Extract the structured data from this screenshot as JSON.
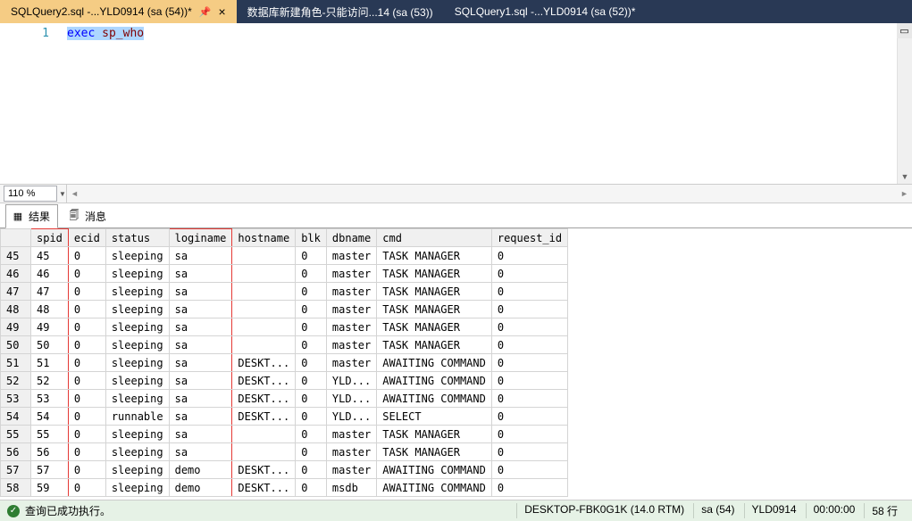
{
  "tabs": [
    {
      "label": "SQLQuery2.sql -...YLD0914 (sa (54))*",
      "active": true,
      "pinned": true
    },
    {
      "label": "数据库新建角色-只能访问...14 (sa (53))",
      "active": false
    },
    {
      "label": "SQLQuery1.sql -...YLD0914 (sa (52))*",
      "active": false
    }
  ],
  "editor": {
    "line_number": "1",
    "code_exec": "exec",
    "code_sp": " sp_who"
  },
  "zoom": {
    "value": "110 %"
  },
  "results_tabs": {
    "results": "结果",
    "messages": "消息"
  },
  "grid": {
    "columns": [
      "spid",
      "ecid",
      "status",
      "loginame",
      "hostname",
      "blk",
      "dbname",
      "cmd",
      "request_id"
    ],
    "rows": [
      {
        "n": "45",
        "spid": "45",
        "ecid": "0",
        "status": "sleeping",
        "loginame": "sa",
        "hostname": "",
        "blk": "0",
        "dbname": "master",
        "cmd": "TASK MANAGER",
        "request_id": "0"
      },
      {
        "n": "46",
        "spid": "46",
        "ecid": "0",
        "status": "sleeping",
        "loginame": "sa",
        "hostname": "",
        "blk": "0",
        "dbname": "master",
        "cmd": "TASK MANAGER",
        "request_id": "0"
      },
      {
        "n": "47",
        "spid": "47",
        "ecid": "0",
        "status": "sleeping",
        "loginame": "sa",
        "hostname": "",
        "blk": "0",
        "dbname": "master",
        "cmd": "TASK MANAGER",
        "request_id": "0"
      },
      {
        "n": "48",
        "spid": "48",
        "ecid": "0",
        "status": "sleeping",
        "loginame": "sa",
        "hostname": "",
        "blk": "0",
        "dbname": "master",
        "cmd": "TASK MANAGER",
        "request_id": "0"
      },
      {
        "n": "49",
        "spid": "49",
        "ecid": "0",
        "status": "sleeping",
        "loginame": "sa",
        "hostname": "",
        "blk": "0",
        "dbname": "master",
        "cmd": "TASK MANAGER",
        "request_id": "0"
      },
      {
        "n": "50",
        "spid": "50",
        "ecid": "0",
        "status": "sleeping",
        "loginame": "sa",
        "hostname": "",
        "blk": "0",
        "dbname": "master",
        "cmd": "TASK MANAGER",
        "request_id": "0"
      },
      {
        "n": "51",
        "spid": "51",
        "ecid": "0",
        "status": "sleeping",
        "loginame": "sa",
        "hostname": "DESKT...",
        "blk": "0",
        "dbname": "master",
        "cmd": "AWAITING COMMAND",
        "request_id": "0"
      },
      {
        "n": "52",
        "spid": "52",
        "ecid": "0",
        "status": "sleeping",
        "loginame": "sa",
        "hostname": "DESKT...",
        "blk": "0",
        "dbname": "YLD...",
        "cmd": "AWAITING COMMAND",
        "request_id": "0"
      },
      {
        "n": "53",
        "spid": "53",
        "ecid": "0",
        "status": "sleeping",
        "loginame": "sa",
        "hostname": "DESKT...",
        "blk": "0",
        "dbname": "YLD...",
        "cmd": "AWAITING COMMAND",
        "request_id": "0"
      },
      {
        "n": "54",
        "spid": "54",
        "ecid": "0",
        "status": "runnable",
        "loginame": "sa",
        "hostname": "DESKT...",
        "blk": "0",
        "dbname": "YLD...",
        "cmd": "SELECT",
        "request_id": "0"
      },
      {
        "n": "55",
        "spid": "55",
        "ecid": "0",
        "status": "sleeping",
        "loginame": "sa",
        "hostname": "",
        "blk": "0",
        "dbname": "master",
        "cmd": "TASK MANAGER",
        "request_id": "0"
      },
      {
        "n": "56",
        "spid": "56",
        "ecid": "0",
        "status": "sleeping",
        "loginame": "sa",
        "hostname": "",
        "blk": "0",
        "dbname": "master",
        "cmd": "TASK MANAGER",
        "request_id": "0"
      },
      {
        "n": "57",
        "spid": "57",
        "ecid": "0",
        "status": "sleeping",
        "loginame": "demo",
        "hostname": "DESKT...",
        "blk": "0",
        "dbname": "master",
        "cmd": "AWAITING COMMAND",
        "request_id": "0"
      },
      {
        "n": "58",
        "spid": "59",
        "ecid": "0",
        "status": "sleeping",
        "loginame": "demo",
        "hostname": "DESKT...",
        "blk": "0",
        "dbname": "msdb",
        "cmd": "AWAITING COMMAND",
        "request_id": "0"
      }
    ]
  },
  "status": {
    "message": "查询已成功执行。",
    "server": "DESKTOP-FBK0G1K (14.0 RTM)",
    "login": "sa (54)",
    "database": "YLD0914",
    "elapsed": "00:00:00",
    "rows": "58 行"
  }
}
